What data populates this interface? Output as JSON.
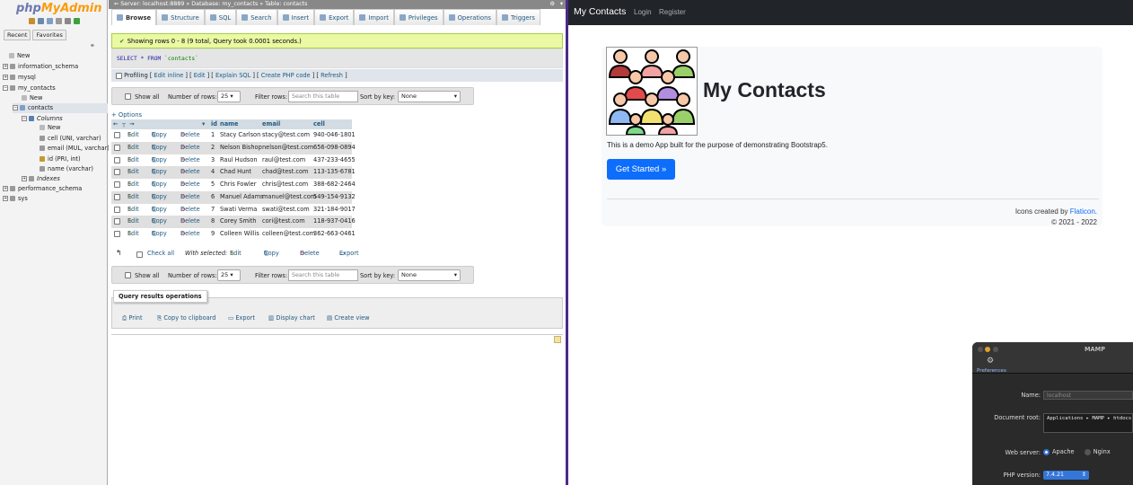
{
  "pma": {
    "logo": {
      "part1": "php",
      "part2": "MyAdmin"
    },
    "nav_tabs": [
      "Recent",
      "Favorites"
    ],
    "tree": {
      "new": "New",
      "dbs": [
        "information_schema",
        "mysql",
        "my_contacts",
        "performance_schema",
        "sys"
      ],
      "my_contacts_new": "New",
      "contacts": "contacts",
      "columns": "Columns",
      "columns_new": "New",
      "cols": [
        "cell (UNI, varchar)",
        "email (MUL, varchar)",
        "id (PRI, int)",
        "name (varchar)"
      ],
      "indexes": "Indexes"
    },
    "breadcrumb": {
      "server": "Server: localhost:8889",
      "database": "Database: my_contacts",
      "table": "Table: contacts"
    },
    "tabs": [
      "Browse",
      "Structure",
      "SQL",
      "Search",
      "Insert",
      "Export",
      "Import",
      "Privileges",
      "Operations",
      "Triggers"
    ],
    "success": "Showing rows 0 - 8 (9 total, Query took 0.0001 seconds.)",
    "sql": {
      "kw1": "SELECT * FROM",
      "str": "`contacts`"
    },
    "profiling": {
      "label": "Profiling",
      "links": [
        "Edit inline",
        "Edit",
        "Explain SQL",
        "Create PHP code",
        "Refresh"
      ]
    },
    "nav": {
      "show_all": "Show all",
      "num_rows_label": "Number of rows:",
      "num_rows": "25",
      "filter_label": "Filter rows:",
      "filter_placeholder": "Search this table",
      "sort_label": "Sort by key:",
      "sort_value": "None"
    },
    "options": "+ Options",
    "columns": [
      "id",
      "name",
      "email",
      "cell"
    ],
    "row_actions": {
      "edit": "Edit",
      "copy": "Copy",
      "delete": "Delete"
    },
    "rows": [
      {
        "id": "1",
        "name": "Stacy Carlson",
        "email": "stacy@test.com",
        "cell": "940-046-1801"
      },
      {
        "id": "2",
        "name": "Nelson Bishop",
        "email": "nelson@test.com",
        "cell": "656-098-0894"
      },
      {
        "id": "3",
        "name": "Raul Hudson",
        "email": "raul@test.com",
        "cell": "437-233-4655"
      },
      {
        "id": "4",
        "name": "Chad Hunt",
        "email": "chad@test.com",
        "cell": "113-135-6781"
      },
      {
        "id": "5",
        "name": "Chris Fowler",
        "email": "chris@test.com",
        "cell": "388-682-2464"
      },
      {
        "id": "6",
        "name": "Manuel Adams",
        "email": "manuel@test.com",
        "cell": "549-154-9132"
      },
      {
        "id": "7",
        "name": "Swati Verma",
        "email": "swati@test.com",
        "cell": "321-184-9017"
      },
      {
        "id": "8",
        "name": "Corey Smith",
        "email": "cori@test.com",
        "cell": "118-937-0416"
      },
      {
        "id": "9",
        "name": "Colleen Willis",
        "email": "colleen@test.com",
        "cell": "362-663-0461"
      }
    ],
    "with_selected": {
      "check_all": "Check all",
      "label": "With selected:",
      "edit": "Edit",
      "copy": "Copy",
      "delete": "Delete",
      "export": "Export"
    },
    "qro": {
      "legend": "Query results operations",
      "ops": [
        "Print",
        "Copy to clipboard",
        "Export",
        "Display chart",
        "Create view"
      ]
    }
  },
  "site": {
    "brand": "My Contacts",
    "links": [
      "Login",
      "Register"
    ],
    "heading": "My Contacts",
    "lead": "This is a demo App built for the purpose of demonstrating Bootstrap5.",
    "button": "Get Started »",
    "credit_prefix": "Icons created by ",
    "credit_link": "Flaticon",
    "credit_suffix": ".",
    "copyright": "© 2021 - 2022"
  },
  "mamp": {
    "title": "MAMP",
    "pref": "Preferences",
    "name_label": "Name:",
    "name_value": "localhost",
    "docroot_label": "Document root:",
    "docroot_value": "Applications ▸ MAMP ▸ htdocs",
    "webserver_label": "Web server:",
    "apache": "Apache",
    "nginx": "Nginx",
    "php_label": "PHP version:",
    "php_value": "7.4.21"
  },
  "colors": {
    "pma_link": "#235a81",
    "bootstrap_primary": "#0d6efd",
    "navbar": "#212529"
  }
}
